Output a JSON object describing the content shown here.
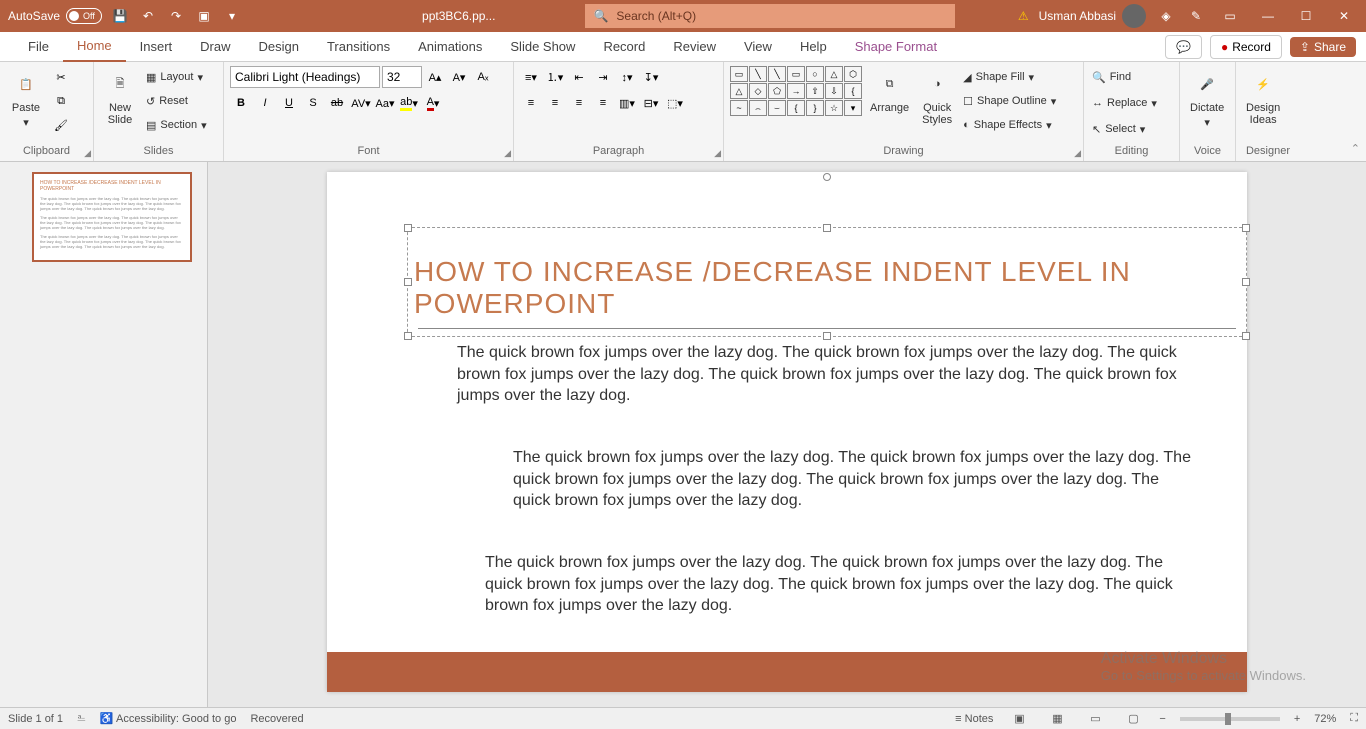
{
  "titlebar": {
    "autosave_label": "AutoSave",
    "autosave_state": "Off",
    "filename": "ppt3BC6.pp...",
    "search_placeholder": "Search (Alt+Q)",
    "username": "Usman Abbasi"
  },
  "tabs": {
    "file": "File",
    "home": "Home",
    "insert": "Insert",
    "draw": "Draw",
    "design": "Design",
    "transitions": "Transitions",
    "animations": "Animations",
    "slideshow": "Slide Show",
    "record": "Record",
    "review": "Review",
    "view": "View",
    "help": "Help",
    "shapeformat": "Shape Format",
    "record_btn": "Record",
    "share_btn": "Share"
  },
  "ribbon": {
    "clipboard": {
      "label": "Clipboard",
      "paste": "Paste"
    },
    "slides": {
      "label": "Slides",
      "new": "New\nSlide",
      "layout": "Layout",
      "reset": "Reset",
      "section": "Section"
    },
    "font": {
      "label": "Font",
      "font_name": "Calibri Light (Headings)",
      "font_size": "32"
    },
    "paragraph": {
      "label": "Paragraph"
    },
    "drawing": {
      "label": "Drawing",
      "arrange": "Arrange",
      "quick": "Quick\nStyles",
      "fill": "Shape Fill",
      "outline": "Shape Outline",
      "effects": "Shape Effects"
    },
    "editing": {
      "label": "Editing",
      "find": "Find",
      "replace": "Replace",
      "select": "Select"
    },
    "voice": {
      "label": "Voice",
      "dictate": "Dictate"
    },
    "designer": {
      "label": "Designer",
      "design": "Design\nIdeas"
    }
  },
  "slide": {
    "title": "HOW TO INCREASE /DECREASE INDENT LEVEL IN POWERPOINT",
    "para1": "The quick brown fox jumps over the lazy dog. The quick brown fox jumps over the lazy dog. The quick brown fox jumps over the lazy dog. The quick brown fox jumps over the lazy dog. The quick brown fox jumps over the lazy dog.",
    "para2": "The quick brown fox jumps over the lazy dog. The quick brown fox jumps over the lazy dog. The quick brown fox jumps over the lazy dog. The quick brown fox jumps over the lazy dog. The quick brown fox jumps over the lazy dog.",
    "para3": "The quick brown fox jumps over the lazy dog. The quick brown fox jumps over the lazy dog. The quick brown fox jumps over the lazy dog. The quick brown fox jumps over the lazy dog. The quick brown fox jumps over the lazy dog."
  },
  "thumb": {
    "num": "1"
  },
  "status": {
    "slide": "Slide 1 of 1",
    "accessibility": "Accessibility: Good to go",
    "recovered": "Recovered",
    "notes": "Notes",
    "zoom": "72%"
  },
  "activate": {
    "title": "Activate Windows",
    "sub": "Go to Settings to activate Windows."
  }
}
